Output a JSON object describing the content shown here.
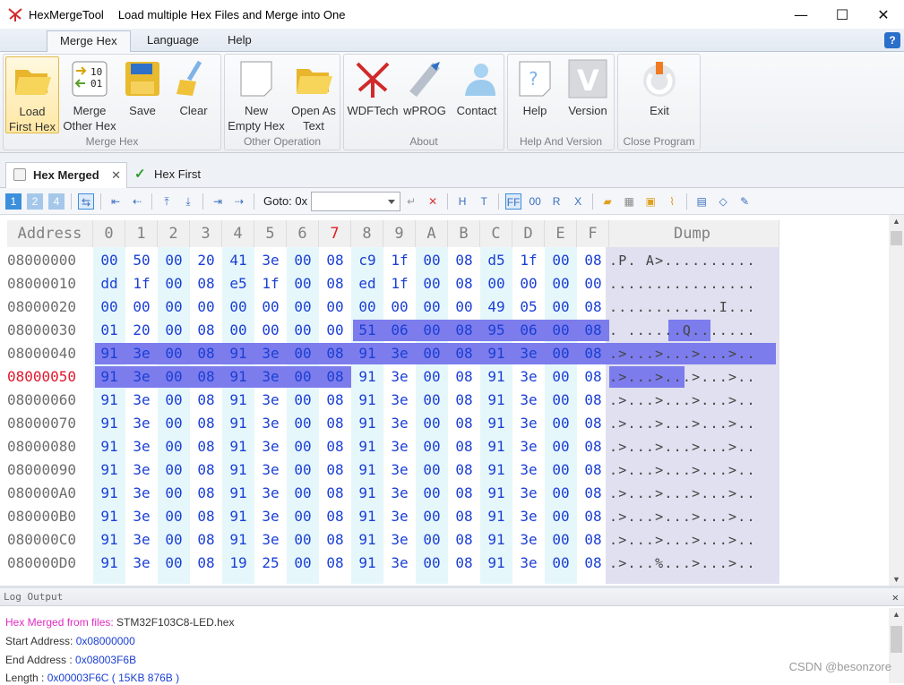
{
  "window": {
    "app_name": "HexMergeTool",
    "subtitle": "Load multiple Hex Files and Merge into One",
    "minimize_glyph": "—",
    "maximize_glyph": "☐",
    "close_glyph": "✕"
  },
  "ribbon_tabs": [
    "Merge Hex",
    "Language",
    "Help"
  ],
  "ribbon": {
    "groups": [
      {
        "label": "Merge Hex",
        "buttons": [
          [
            "Load",
            "First Hex"
          ],
          [
            "Merge",
            "Other Hex"
          ],
          [
            "Save",
            ""
          ],
          [
            "Clear",
            ""
          ]
        ]
      },
      {
        "label": "Other Operation",
        "buttons": [
          [
            "New",
            "Empty Hex"
          ],
          [
            "Open As",
            "Text"
          ]
        ]
      },
      {
        "label": "About",
        "buttons": [
          [
            "WDFTech",
            ""
          ],
          [
            "wPROG",
            ""
          ],
          [
            "Contact",
            ""
          ]
        ]
      },
      {
        "label": "Help And Version",
        "buttons": [
          [
            "Help",
            ""
          ],
          [
            "Version",
            ""
          ]
        ]
      },
      {
        "label": "Close Program",
        "buttons": [
          [
            "Exit",
            ""
          ]
        ]
      }
    ]
  },
  "doc_tabs": [
    "Hex Merged",
    "Hex First"
  ],
  "toolbar": {
    "goto_label": "Goto: 0x",
    "goto_value": "",
    "mode_h": "H",
    "mode_t": "T",
    "mode_ff": "FF",
    "mode_00": "00",
    "mode_r": "R",
    "mode_x": "X"
  },
  "hex": {
    "address_header": "Address",
    "columns": [
      "0",
      "1",
      "2",
      "3",
      "4",
      "5",
      "6",
      "7",
      "8",
      "9",
      "A",
      "B",
      "C",
      "D",
      "E",
      "F"
    ],
    "dump_header": "Dump",
    "rows": [
      {
        "addr": "08000000",
        "bytes": [
          "00",
          "50",
          "00",
          "20",
          "41",
          "3e",
          "00",
          "08",
          "c9",
          "1f",
          "00",
          "08",
          "d5",
          "1f",
          "00",
          "08"
        ],
        "dump": ".P. A>.........."
      },
      {
        "addr": "08000010",
        "bytes": [
          "dd",
          "1f",
          "00",
          "08",
          "e5",
          "1f",
          "00",
          "08",
          "ed",
          "1f",
          "00",
          "08",
          "00",
          "00",
          "00",
          "00"
        ],
        "dump": "................"
      },
      {
        "addr": "08000020",
        "bytes": [
          "00",
          "00",
          "00",
          "00",
          "00",
          "00",
          "00",
          "00",
          "00",
          "00",
          "00",
          "00",
          "49",
          "05",
          "00",
          "08"
        ],
        "dump": "............I..."
      },
      {
        "addr": "08000030",
        "bytes": [
          "01",
          "20",
          "00",
          "08",
          "00",
          "00",
          "00",
          "00",
          "51",
          "06",
          "00",
          "08",
          "95",
          "06",
          "00",
          "08"
        ],
        "dump": ". ......Q......."
      },
      {
        "addr": "08000040",
        "bytes": [
          "91",
          "3e",
          "00",
          "08",
          "91",
          "3e",
          "00",
          "08",
          "91",
          "3e",
          "00",
          "08",
          "91",
          "3e",
          "00",
          "08"
        ],
        "dump": ".>...>...>...>.."
      },
      {
        "addr": "08000050",
        "bytes": [
          "91",
          "3e",
          "00",
          "08",
          "91",
          "3e",
          "00",
          "08",
          "91",
          "3e",
          "00",
          "08",
          "91",
          "3e",
          "00",
          "08"
        ],
        "dump": ".>...>...>...>.."
      },
      {
        "addr": "08000060",
        "bytes": [
          "91",
          "3e",
          "00",
          "08",
          "91",
          "3e",
          "00",
          "08",
          "91",
          "3e",
          "00",
          "08",
          "91",
          "3e",
          "00",
          "08"
        ],
        "dump": ".>...>...>...>.."
      },
      {
        "addr": "08000070",
        "bytes": [
          "91",
          "3e",
          "00",
          "08",
          "91",
          "3e",
          "00",
          "08",
          "91",
          "3e",
          "00",
          "08",
          "91",
          "3e",
          "00",
          "08"
        ],
        "dump": ".>...>...>...>.."
      },
      {
        "addr": "08000080",
        "bytes": [
          "91",
          "3e",
          "00",
          "08",
          "91",
          "3e",
          "00",
          "08",
          "91",
          "3e",
          "00",
          "08",
          "91",
          "3e",
          "00",
          "08"
        ],
        "dump": ".>...>...>...>.."
      },
      {
        "addr": "08000090",
        "bytes": [
          "91",
          "3e",
          "00",
          "08",
          "91",
          "3e",
          "00",
          "08",
          "91",
          "3e",
          "00",
          "08",
          "91",
          "3e",
          "00",
          "08"
        ],
        "dump": ".>...>...>...>.."
      },
      {
        "addr": "080000A0",
        "bytes": [
          "91",
          "3e",
          "00",
          "08",
          "91",
          "3e",
          "00",
          "08",
          "91",
          "3e",
          "00",
          "08",
          "91",
          "3e",
          "00",
          "08"
        ],
        "dump": ".>...>...>...>.."
      },
      {
        "addr": "080000B0",
        "bytes": [
          "91",
          "3e",
          "00",
          "08",
          "91",
          "3e",
          "00",
          "08",
          "91",
          "3e",
          "00",
          "08",
          "91",
          "3e",
          "00",
          "08"
        ],
        "dump": ".>...>...>...>.."
      },
      {
        "addr": "080000C0",
        "bytes": [
          "91",
          "3e",
          "00",
          "08",
          "91",
          "3e",
          "00",
          "08",
          "91",
          "3e",
          "00",
          "08",
          "91",
          "3e",
          "00",
          "08"
        ],
        "dump": ".>...>...>...>.."
      },
      {
        "addr": "080000D0",
        "bytes": [
          "91",
          "3e",
          "00",
          "08",
          "19",
          "25",
          "00",
          "08",
          "91",
          "3e",
          "00",
          "08",
          "91",
          "3e",
          "00",
          "08"
        ],
        "dump": ".>...%...>...>.."
      }
    ]
  },
  "log": {
    "header": "Log Output",
    "lines": [
      {
        "key": "Hex Merged from files: ",
        "value": "STM32F103C8-LED.hex"
      },
      {
        "key": "Start Address: ",
        "value": "0x08000000"
      },
      {
        "key": "End Address  : ",
        "value": "0x08003F6B"
      },
      {
        "key": "Length       : ",
        "value": "0x00003F6C ( 15KB 876B )"
      }
    ]
  },
  "watermark": "CSDN @besonzore"
}
